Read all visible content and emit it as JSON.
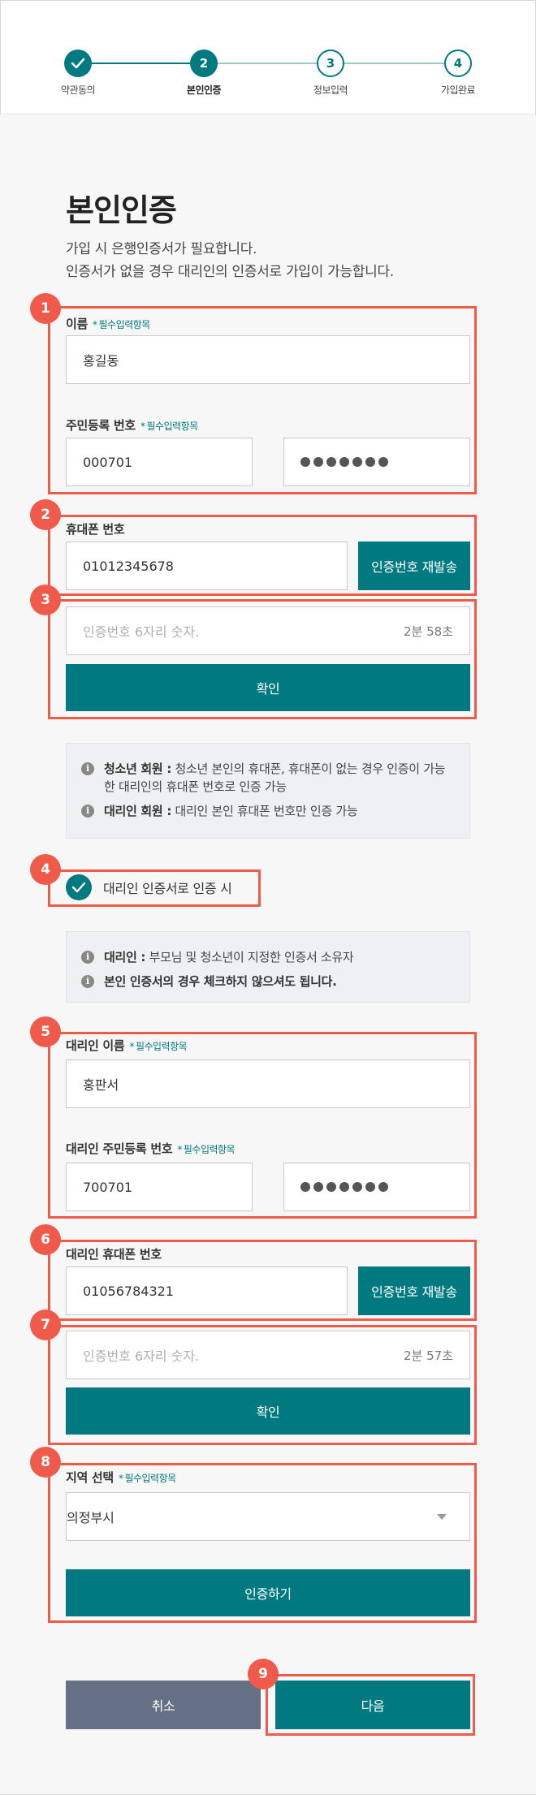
{
  "steps": [
    {
      "label": "약관동의",
      "number": "1",
      "state": "done"
    },
    {
      "label": "본인인증",
      "number": "2",
      "state": "current"
    },
    {
      "label": "정보입력",
      "number": "3",
      "state": "todo"
    },
    {
      "label": "가입완료",
      "number": "4",
      "state": "todo"
    }
  ],
  "title": "본인인증",
  "description": [
    "가입 시 은행인증서가 필요합니다.",
    "인증서가 없을 경우 대리인의 인증서로 가입이 가능합니다."
  ],
  "required_mark": "*",
  "required_text": "필수입력항목",
  "name_label": "이름",
  "name_value": "홍길동",
  "rrn_label": "주민등록 번호",
  "rrn_front": "000701",
  "phone_label": "휴대폰 번호",
  "phone_value": "01012345678",
  "resend_label": "인증번호 재발송",
  "code_placeholder": "인증번호 6자리 숫자.",
  "timer_1": "2분 58초",
  "confirm_label": "확인",
  "info1": [
    {
      "bold": "청소년 회원 :",
      "text": " 청소년 본인의 휴대폰, 휴대폰이 없는 경우 인증이 가능한 대리인의 휴대폰 번호로 인증 가능"
    },
    {
      "bold": "대리인 회원 :",
      "text": " 대리인 본인 휴대폰 번호만 인증 가능"
    }
  ],
  "proxy_check_label": "대리인 인증서로 인증 시",
  "proxy_checked": true,
  "info2": [
    {
      "bold": "대리인 :",
      "text": " 부모님 및 청소년이 지정한 인증서 소유자"
    },
    {
      "bold": "",
      "text": "본인 인증서의 경우 체크하지 않으셔도 됩니다."
    }
  ],
  "proxy_name_label": "대리인 이름",
  "proxy_name_value": "홍판서",
  "proxy_rrn_label": "대리인 주민등록 번호",
  "proxy_rrn_front": "700701",
  "proxy_phone_label": "대리인 휴대폰 번호",
  "proxy_phone_value": "01056784321",
  "timer_2": "2분 57초",
  "region_label": "지역 선택",
  "region_value": "의정부시",
  "verify_label": "인증하기",
  "cancel_label": "취소",
  "next_label": "다음",
  "badges": [
    "1",
    "2",
    "3",
    "4",
    "5",
    "6",
    "7",
    "8",
    "9"
  ],
  "colors": {
    "accent": "#007a80",
    "highlight": "#f05a4a",
    "cancel": "#667085"
  }
}
